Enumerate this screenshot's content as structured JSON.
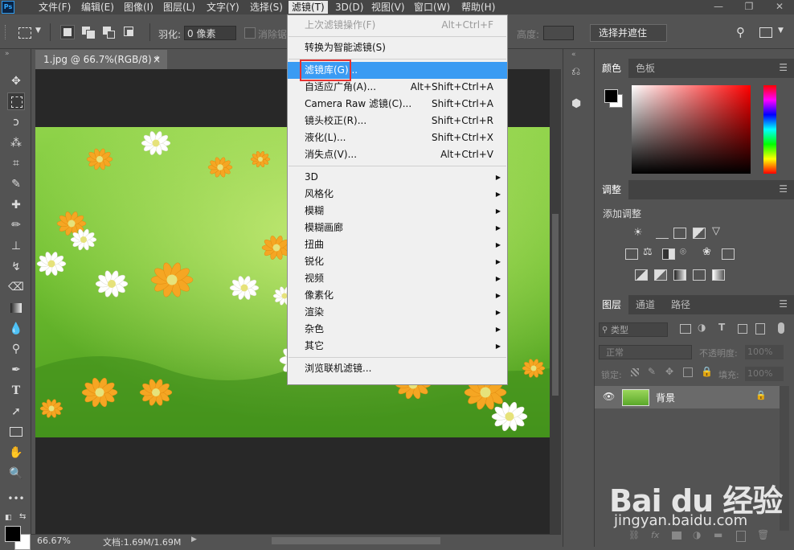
{
  "app": {
    "logo": "Ps"
  },
  "menubar": {
    "items": [
      "文件(F)",
      "编辑(E)",
      "图像(I)",
      "图层(L)",
      "文字(Y)",
      "选择(S)",
      "滤镜(T)",
      "3D(D)",
      "视图(V)",
      "窗口(W)",
      "帮助(H)"
    ],
    "active": "滤镜(T)"
  },
  "options_bar": {
    "feather_label": "羽化:",
    "feather_value": "0 像素",
    "antialias_label": "消除锯齿",
    "height_label": "高度:",
    "select_mask_button": "选择并遮住 ..."
  },
  "document": {
    "tab_title": "1.jpg @ 66.7%(RGB/8) *",
    "tab_close": "×",
    "zoom": "66.67%",
    "doc_info": "文档:1.69M/1.69M"
  },
  "filter_menu": {
    "items": [
      {
        "label": "上次滤镜操作(F)",
        "shortcut": "Alt+Ctrl+F",
        "disabled": true
      },
      {
        "sep": true
      },
      {
        "label": "转换为智能滤镜(S)"
      },
      {
        "sep": true
      },
      {
        "label": "滤镜库(G)...",
        "highlighted": true
      },
      {
        "label": "自适应广角(A)...",
        "shortcut": "Alt+Shift+Ctrl+A"
      },
      {
        "label": "Camera Raw 滤镜(C)...",
        "shortcut": "Shift+Ctrl+A"
      },
      {
        "label": "镜头校正(R)...",
        "shortcut": "Shift+Ctrl+R"
      },
      {
        "label": "液化(L)...",
        "shortcut": "Shift+Ctrl+X"
      },
      {
        "label": "消失点(V)...",
        "shortcut": "Alt+Ctrl+V"
      },
      {
        "sep": true
      },
      {
        "label": "3D",
        "submenu": true
      },
      {
        "label": "风格化",
        "submenu": true
      },
      {
        "label": "模糊",
        "submenu": true
      },
      {
        "label": "模糊画廊",
        "submenu": true
      },
      {
        "label": "扭曲",
        "submenu": true
      },
      {
        "label": "锐化",
        "submenu": true
      },
      {
        "label": "视频",
        "submenu": true
      },
      {
        "label": "像素化",
        "submenu": true
      },
      {
        "label": "渲染",
        "submenu": true
      },
      {
        "label": "杂色",
        "submenu": true
      },
      {
        "label": "其它",
        "submenu": true
      },
      {
        "sep": true
      },
      {
        "label": "浏览联机滤镜..."
      }
    ]
  },
  "color_panel": {
    "tabs": [
      "颜色",
      "色板"
    ]
  },
  "adjust_panel": {
    "tab": "调整",
    "title": "添加调整"
  },
  "layers_panel": {
    "tabs": [
      "图层",
      "通道",
      "路径"
    ],
    "filter_kind": "类型",
    "blend_mode": "正常",
    "opacity_label": "不透明度:",
    "opacity_value": "100%",
    "lock_label": "锁定:",
    "fill_label": "填充:",
    "fill_value": "100%",
    "layers": [
      {
        "name": "背景",
        "visible": true,
        "locked": true
      }
    ]
  },
  "watermark": {
    "logo": "Bai du 经验",
    "sub": "jingyan.baidu.com"
  },
  "colors": {
    "accent": "#3a9bf3",
    "highlight_box": "#e53232"
  }
}
